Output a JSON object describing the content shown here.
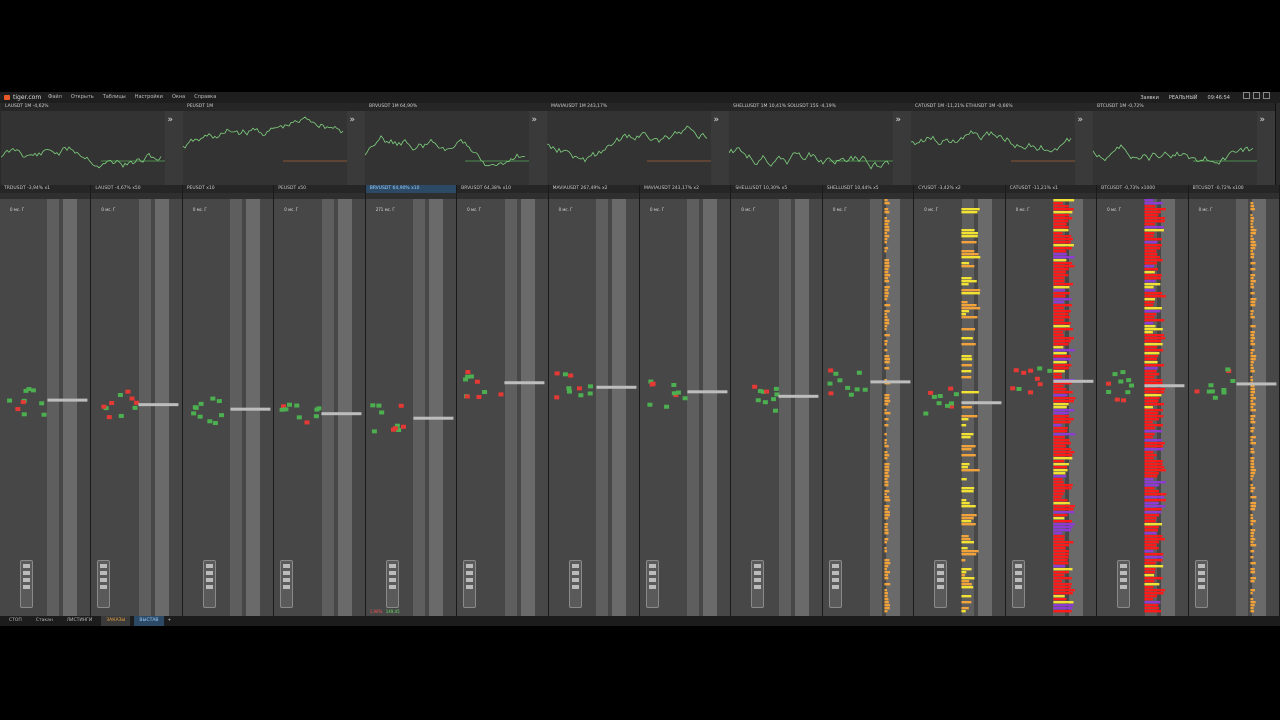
{
  "app": {
    "brand": "tiger.com"
  },
  "menu": [
    "Файл",
    "Открыть",
    "Таблицы",
    "Настройки",
    "Окна",
    "Справка"
  ],
  "topright": {
    "orders": "Заявки",
    "mode": "РЕАЛЬНЫЙ",
    "clock": "09:46:54"
  },
  "mini_charts": [
    {
      "title": "LAUSDT 1M -4,62%",
      "tone": "#d77"
    },
    {
      "title": "PEUSDT 1M",
      "tone": "#8a7ae0"
    },
    {
      "title": "BRVUSDT 1M 64,90%",
      "tone": "#8a7ae0"
    },
    {
      "title": "MAVIAUSDT 1M 243,17%",
      "tone": "#e0c040"
    },
    {
      "title": "SHELLUSDT 1M 10,41%   SOLUSDT 15S -4,19%",
      "tone": "#8a7ae0"
    },
    {
      "title": "CATUSDT 1M -11,21%   ETHUSDT 1M -0,66%",
      "tone": "#3ac0c0"
    },
    {
      "title": "BTCUSDT 1M -0,72%",
      "tone": "#8a7ae0"
    }
  ],
  "panes": [
    {
      "title": "TRDUSDT -3,94% x1",
      "status": "0 мс. Г",
      "foot": "",
      "foot2": "",
      "selected": false
    },
    {
      "title": "LAUSDT -4,67% x50",
      "status": "0 мс. Г",
      "foot": "",
      "foot2": "",
      "selected": false
    },
    {
      "title": "PEUSDT x10",
      "status": "0 мс. Г",
      "foot": "",
      "foot2": "",
      "selected": false
    },
    {
      "title": "PEUSDT x50",
      "status": "0 мс. Г",
      "foot": "",
      "foot2": "",
      "selected": false
    },
    {
      "title": "BRVUSDT 64,90% x10",
      "status": "271 мс. Г",
      "foot": "1,98%",
      "foot2": "149,45",
      "selected": true
    },
    {
      "title": "BRVUSDT 64,38% x10",
      "status": "0 мс. Г",
      "foot": "",
      "foot2": "",
      "selected": false
    },
    {
      "title": "MAVIAUSDT 267,49% x2",
      "status": "0 мс. Г",
      "foot": "",
      "foot2": "",
      "selected": false
    },
    {
      "title": "MAVIAUSDT 243,17% x2",
      "status": "0 мс. Г",
      "foot": "",
      "foot2": "",
      "selected": false
    },
    {
      "title": "SHELLUSDT 10,30% x5",
      "status": "0 мс. Г",
      "foot": "",
      "foot2": "",
      "selected": false
    },
    {
      "title": "SHELLUSDT 10,44% x5",
      "status": "0 мс. Г",
      "foot": "",
      "foot2": "",
      "selected": false
    },
    {
      "title": "CYUSDT -3,42% x2",
      "status": "0 мс. Г",
      "foot": "",
      "foot2": "",
      "selected": false
    },
    {
      "title": "CATUSDT -11,21% x1",
      "status": "0 мс. Г",
      "foot": "",
      "foot2": "",
      "selected": false
    },
    {
      "title": "BTCUSDT -0,73% x1000",
      "status": "0 мс. Г",
      "foot": "",
      "foot2": "",
      "selected": false
    },
    {
      "title": "BTCUSDT -0,72% x100",
      "status": "0 мс. Г",
      "foot": "",
      "foot2": "",
      "selected": false
    }
  ],
  "taskbar": {
    "tabs": [
      "СТОП",
      "Стакан",
      "ЛИСТИНГИ",
      "ЗАКАЗЫ",
      "ВЫСТАВ"
    ],
    "active": 3,
    "current": 4,
    "plus": "+"
  },
  "colors": {
    "bid": "#4caf50",
    "ask": "#e53935",
    "big": "#ff1a1a",
    "purple": "#8e3bd6",
    "yellow": "#f2e233",
    "orange": "#f2a23a"
  }
}
